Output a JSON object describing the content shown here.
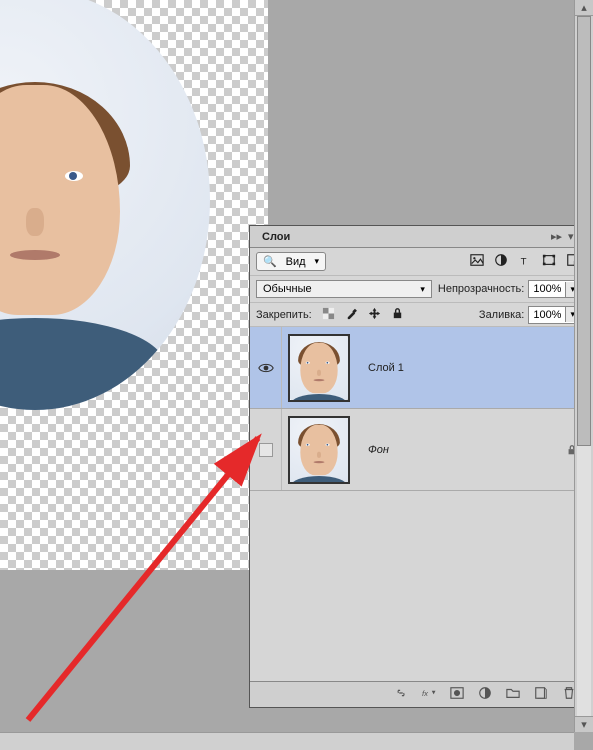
{
  "panel": {
    "title": "Слои",
    "filter_label": "Вид",
    "blend_mode": "Обычные",
    "opacity_label": "Непрозрачность:",
    "opacity_value": "100%",
    "lock_label": "Закрепить:",
    "fill_label": "Заливка:",
    "fill_value": "100%"
  },
  "layers": [
    {
      "name": "Слой 1",
      "visible": true,
      "locked": false,
      "active": true
    },
    {
      "name": "Фон",
      "visible": false,
      "locked": true,
      "active": false
    }
  ],
  "icons": {
    "search": "search-icon",
    "expand": "expand-icon",
    "menu": "menu-icon",
    "image_filter": "image-filon",
    "adjust_filter": "adjustment-icon",
    "text_filter": "text-icon",
    "shape_filter": "shape-icon",
    "smart_filter": "smart-object-icon",
    "lock_trans": "lock-transparency-icon",
    "lock_paint": "lock-paint-icon",
    "lock_move": "lock-move-icon",
    "lock_all": "lock-all-icon",
    "eye": "eye-icon",
    "lock": "lock-icon",
    "link": "link-icon",
    "fx": "fx-icon",
    "mask": "mask-icon",
    "adjustment": "fill-adjustment-icon",
    "group": "group-icon",
    "new": "new-layer-icon",
    "trash": "trash-icon"
  }
}
